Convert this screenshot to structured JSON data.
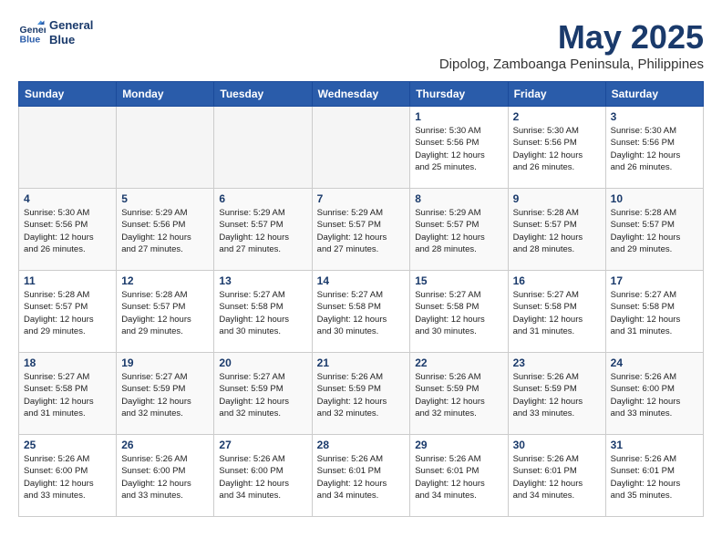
{
  "header": {
    "logo_line1": "General",
    "logo_line2": "Blue",
    "title": "May 2025",
    "subtitle": "Dipolog, Zamboanga Peninsula, Philippines"
  },
  "columns": [
    "Sunday",
    "Monday",
    "Tuesday",
    "Wednesday",
    "Thursday",
    "Friday",
    "Saturday"
  ],
  "weeks": [
    [
      {
        "day": "",
        "info": ""
      },
      {
        "day": "",
        "info": ""
      },
      {
        "day": "",
        "info": ""
      },
      {
        "day": "",
        "info": ""
      },
      {
        "day": "1",
        "info": "Sunrise: 5:30 AM\nSunset: 5:56 PM\nDaylight: 12 hours\nand 25 minutes."
      },
      {
        "day": "2",
        "info": "Sunrise: 5:30 AM\nSunset: 5:56 PM\nDaylight: 12 hours\nand 26 minutes."
      },
      {
        "day": "3",
        "info": "Sunrise: 5:30 AM\nSunset: 5:56 PM\nDaylight: 12 hours\nand 26 minutes."
      }
    ],
    [
      {
        "day": "4",
        "info": "Sunrise: 5:30 AM\nSunset: 5:56 PM\nDaylight: 12 hours\nand 26 minutes."
      },
      {
        "day": "5",
        "info": "Sunrise: 5:29 AM\nSunset: 5:56 PM\nDaylight: 12 hours\nand 27 minutes."
      },
      {
        "day": "6",
        "info": "Sunrise: 5:29 AM\nSunset: 5:57 PM\nDaylight: 12 hours\nand 27 minutes."
      },
      {
        "day": "7",
        "info": "Sunrise: 5:29 AM\nSunset: 5:57 PM\nDaylight: 12 hours\nand 27 minutes."
      },
      {
        "day": "8",
        "info": "Sunrise: 5:29 AM\nSunset: 5:57 PM\nDaylight: 12 hours\nand 28 minutes."
      },
      {
        "day": "9",
        "info": "Sunrise: 5:28 AM\nSunset: 5:57 PM\nDaylight: 12 hours\nand 28 minutes."
      },
      {
        "day": "10",
        "info": "Sunrise: 5:28 AM\nSunset: 5:57 PM\nDaylight: 12 hours\nand 29 minutes."
      }
    ],
    [
      {
        "day": "11",
        "info": "Sunrise: 5:28 AM\nSunset: 5:57 PM\nDaylight: 12 hours\nand 29 minutes."
      },
      {
        "day": "12",
        "info": "Sunrise: 5:28 AM\nSunset: 5:57 PM\nDaylight: 12 hours\nand 29 minutes."
      },
      {
        "day": "13",
        "info": "Sunrise: 5:27 AM\nSunset: 5:58 PM\nDaylight: 12 hours\nand 30 minutes."
      },
      {
        "day": "14",
        "info": "Sunrise: 5:27 AM\nSunset: 5:58 PM\nDaylight: 12 hours\nand 30 minutes."
      },
      {
        "day": "15",
        "info": "Sunrise: 5:27 AM\nSunset: 5:58 PM\nDaylight: 12 hours\nand 30 minutes."
      },
      {
        "day": "16",
        "info": "Sunrise: 5:27 AM\nSunset: 5:58 PM\nDaylight: 12 hours\nand 31 minutes."
      },
      {
        "day": "17",
        "info": "Sunrise: 5:27 AM\nSunset: 5:58 PM\nDaylight: 12 hours\nand 31 minutes."
      }
    ],
    [
      {
        "day": "18",
        "info": "Sunrise: 5:27 AM\nSunset: 5:58 PM\nDaylight: 12 hours\nand 31 minutes."
      },
      {
        "day": "19",
        "info": "Sunrise: 5:27 AM\nSunset: 5:59 PM\nDaylight: 12 hours\nand 32 minutes."
      },
      {
        "day": "20",
        "info": "Sunrise: 5:27 AM\nSunset: 5:59 PM\nDaylight: 12 hours\nand 32 minutes."
      },
      {
        "day": "21",
        "info": "Sunrise: 5:26 AM\nSunset: 5:59 PM\nDaylight: 12 hours\nand 32 minutes."
      },
      {
        "day": "22",
        "info": "Sunrise: 5:26 AM\nSunset: 5:59 PM\nDaylight: 12 hours\nand 32 minutes."
      },
      {
        "day": "23",
        "info": "Sunrise: 5:26 AM\nSunset: 5:59 PM\nDaylight: 12 hours\nand 33 minutes."
      },
      {
        "day": "24",
        "info": "Sunrise: 5:26 AM\nSunset: 6:00 PM\nDaylight: 12 hours\nand 33 minutes."
      }
    ],
    [
      {
        "day": "25",
        "info": "Sunrise: 5:26 AM\nSunset: 6:00 PM\nDaylight: 12 hours\nand 33 minutes."
      },
      {
        "day": "26",
        "info": "Sunrise: 5:26 AM\nSunset: 6:00 PM\nDaylight: 12 hours\nand 33 minutes."
      },
      {
        "day": "27",
        "info": "Sunrise: 5:26 AM\nSunset: 6:00 PM\nDaylight: 12 hours\nand 34 minutes."
      },
      {
        "day": "28",
        "info": "Sunrise: 5:26 AM\nSunset: 6:01 PM\nDaylight: 12 hours\nand 34 minutes."
      },
      {
        "day": "29",
        "info": "Sunrise: 5:26 AM\nSunset: 6:01 PM\nDaylight: 12 hours\nand 34 minutes."
      },
      {
        "day": "30",
        "info": "Sunrise: 5:26 AM\nSunset: 6:01 PM\nDaylight: 12 hours\nand 34 minutes."
      },
      {
        "day": "31",
        "info": "Sunrise: 5:26 AM\nSunset: 6:01 PM\nDaylight: 12 hours\nand 35 minutes."
      }
    ]
  ]
}
